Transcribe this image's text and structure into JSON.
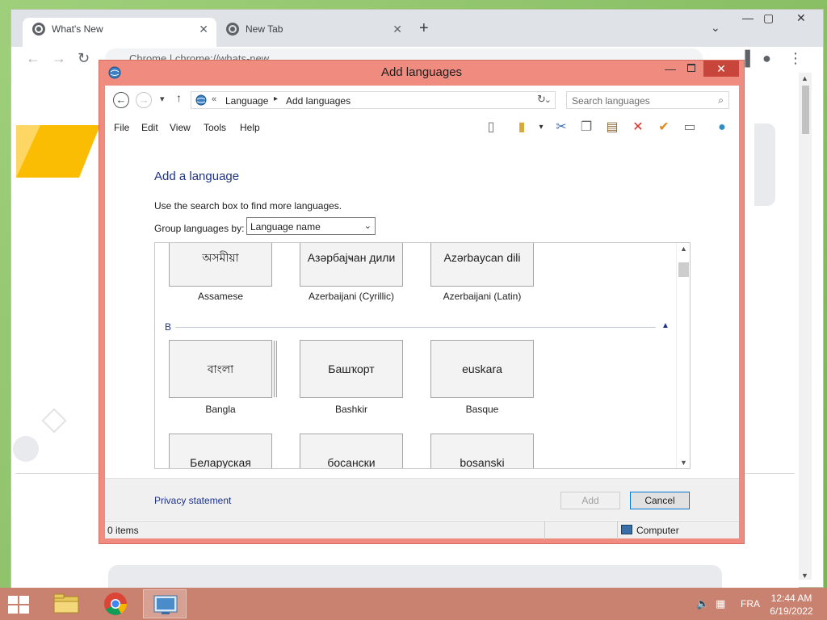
{
  "browser": {
    "tabs": [
      {
        "label": "What's New",
        "active": true
      },
      {
        "label": "New Tab",
        "active": false
      }
    ],
    "new_tab_symbol": "+",
    "omnibox_text": "Chrome   |  chrome://whats-new"
  },
  "dialog": {
    "title": "Add languages",
    "breadcrumb": [
      "Language",
      "Add languages"
    ],
    "breadcrumb_prefix": "«",
    "search_placeholder": "Search languages",
    "menu": [
      "File",
      "Edit",
      "View",
      "Tools",
      "Help"
    ],
    "heading": "Add a language",
    "instruction": "Use the search box to find more languages.",
    "group_by_label": "Group languages by:",
    "group_by_value": "Language name",
    "group_b_label": "B",
    "languages_row1": [
      {
        "native": "অসমীয়া",
        "name": "Assamese"
      },
      {
        "native": "Азәрбајҹан дили",
        "name": "Azerbaijani (Cyrillic)"
      },
      {
        "native": "Azərbaycan dili",
        "name": "Azerbaijani (Latin)"
      }
    ],
    "languages_row2": [
      {
        "native": "বাংলা",
        "name": "Bangla"
      },
      {
        "native": "Башҡорт",
        "name": "Bashkir"
      },
      {
        "native": "euskara",
        "name": "Basque"
      }
    ],
    "languages_row3": [
      {
        "native": "Беларуская"
      },
      {
        "native": "босански"
      },
      {
        "native": "bosanski"
      }
    ],
    "privacy_link": "Privacy statement",
    "add_button": "Add",
    "cancel_button": "Cancel",
    "status_items": "0 items",
    "status_location": "Computer"
  },
  "taskbar": {
    "language": "FRA",
    "time": "12:44 AM",
    "date": "6/19/2022"
  },
  "colors": {
    "dialog_frame": "#f08b7f",
    "close_button": "#c7453a",
    "taskbar": "#c9826f",
    "heading_blue": "#1e3287"
  }
}
